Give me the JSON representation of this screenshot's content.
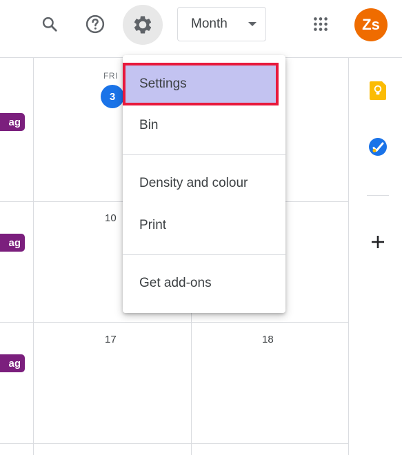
{
  "header": {
    "view_selector": {
      "label": "Month"
    },
    "avatar_initials": "Zs",
    "avatar_color": "#ef6c00"
  },
  "calendar": {
    "columns": [
      {
        "day_label": "FRI",
        "date": "3",
        "is_today": true
      },
      {
        "day_label": "",
        "date": ""
      }
    ],
    "week_rows": [
      {
        "dates": [
          "10",
          ""
        ]
      },
      {
        "dates": [
          "17",
          "18"
        ]
      }
    ],
    "event_chip_text": "ag",
    "event_chip_color": "#7b1f7d",
    "today_color": "#1a73e8"
  },
  "menu": {
    "items": [
      {
        "label": "Settings",
        "highlighted": true
      },
      {
        "label": "Bin"
      },
      {
        "label": "Density and colour"
      },
      {
        "label": "Print"
      },
      {
        "label": "Get add-ons"
      }
    ]
  },
  "side_panel": {
    "icons": [
      "keep-icon",
      "tasks-icon",
      "add-icon"
    ]
  }
}
